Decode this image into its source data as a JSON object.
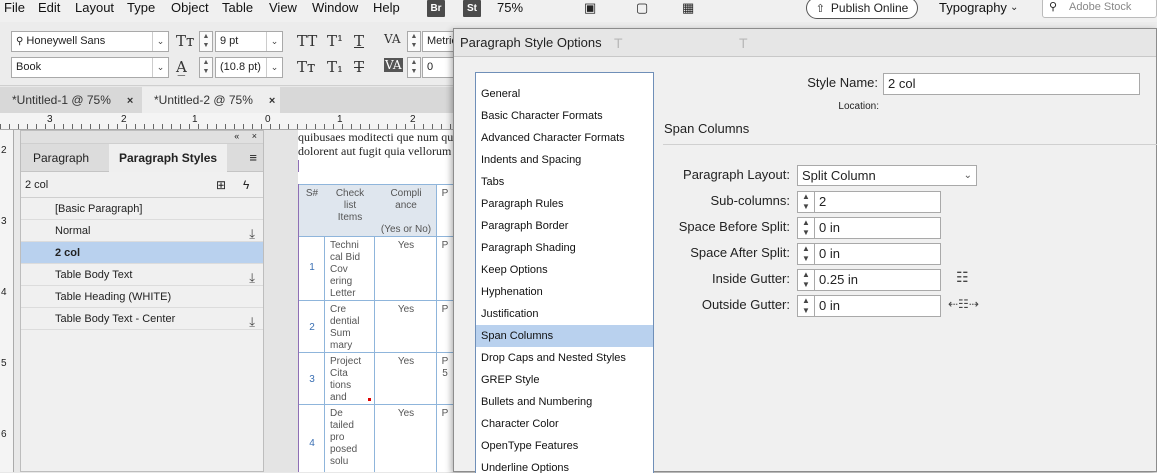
{
  "menubar": {
    "items": [
      "File",
      "Edit",
      "Layout",
      "Type",
      "Object",
      "Table",
      "View",
      "Window",
      "Help"
    ],
    "app_badges": [
      "Br",
      "St"
    ],
    "zoom": "75%",
    "publish_label": "Publish Online",
    "workspace": "Typography",
    "stock_search_placeholder": "Adobe Stock"
  },
  "control": {
    "font_family": "Honeywell Sans",
    "font_style": "Book",
    "font_size": "9 pt",
    "leading": "(10.8 pt)",
    "kerning": "Metric",
    "tracking": "0"
  },
  "doc_tabs": [
    {
      "label": "*Untitled-1 @ 75%",
      "close": "×"
    },
    {
      "label": "*Untitled-2 @ 75%",
      "close": "×"
    }
  ],
  "ruler": {
    "h_numbers": [
      "3",
      "2",
      "1",
      "0",
      "1",
      "2"
    ],
    "v_numbers": [
      "2",
      "3",
      "4",
      "5",
      "6"
    ]
  },
  "styles_panel": {
    "tab_paragraph": "Paragraph",
    "tab_paragraph_styles": "Paragraph Styles",
    "current_style": "2 col",
    "styles": [
      {
        "name": "[Basic Paragraph]",
        "icon": false
      },
      {
        "name": "Normal",
        "icon": true
      },
      {
        "name": "2 col",
        "icon": false,
        "selected": true
      },
      {
        "name": "Table Body Text",
        "icon": true
      },
      {
        "name": "Table Heading (WHITE)",
        "icon": false
      },
      {
        "name": "Table Body Text - Center",
        "icon": true
      }
    ]
  },
  "document": {
    "line1": "quibusaes moditecti que num qu",
    "line2": "dolorent aut fugit quia vellorum",
    "header": {
      "col1": "S#",
      "col2": [
        "Check",
        "list",
        "Items"
      ],
      "col3": [
        "Compli",
        "ance"
      ],
      "col3_sub": "(Yes or No)",
      "col4": "P"
    },
    "rows": [
      {
        "num": "1",
        "item": [
          "Techni",
          "cal Bid",
          "Cov",
          "ering",
          "Letter"
        ],
        "val": "Yes",
        "p": "P"
      },
      {
        "num": "2",
        "item": [
          "Cre",
          "dential",
          "Sum",
          "mary"
        ],
        "val": "Yes",
        "p": "P"
      },
      {
        "num": "3",
        "item": [
          "Project",
          "Cita",
          "tions",
          "and"
        ],
        "val": "Yes",
        "p": "P",
        "p2": "5"
      },
      {
        "num": "4",
        "item": [
          "De",
          "tailed",
          "pro",
          "posed",
          "solu"
        ],
        "val": "Yes",
        "p": "P"
      }
    ]
  },
  "dialog": {
    "title": "Paragraph Style Options",
    "style_name_label": "Style Name:",
    "style_name_value": "2 col",
    "location_label": "Location:",
    "section_title": "Span Columns",
    "categories": [
      "General",
      "Basic Character Formats",
      "Advanced Character Formats",
      "Indents and Spacing",
      "Tabs",
      "Paragraph Rules",
      "Paragraph Border",
      "Paragraph Shading",
      "Keep Options",
      "Hyphenation",
      "Justification",
      "Span Columns",
      "Drop Caps and Nested Styles",
      "GREP Style",
      "Bullets and Numbering",
      "Character Color",
      "OpenType Features",
      "Underline Options"
    ],
    "selected_category": "Span Columns",
    "fields": {
      "paragraph_layout_label": "Paragraph Layout:",
      "paragraph_layout_value": "Split Column",
      "sub_columns_label": "Sub-columns:",
      "sub_columns_value": "2",
      "space_before_label": "Space Before Split:",
      "space_before_value": "0 in",
      "space_after_label": "Space After Split:",
      "space_after_value": "0 in",
      "inside_gutter_label": "Inside Gutter:",
      "inside_gutter_value": "0.25 in",
      "outside_gutter_label": "Outside Gutter:",
      "outside_gutter_value": "0 in"
    }
  }
}
